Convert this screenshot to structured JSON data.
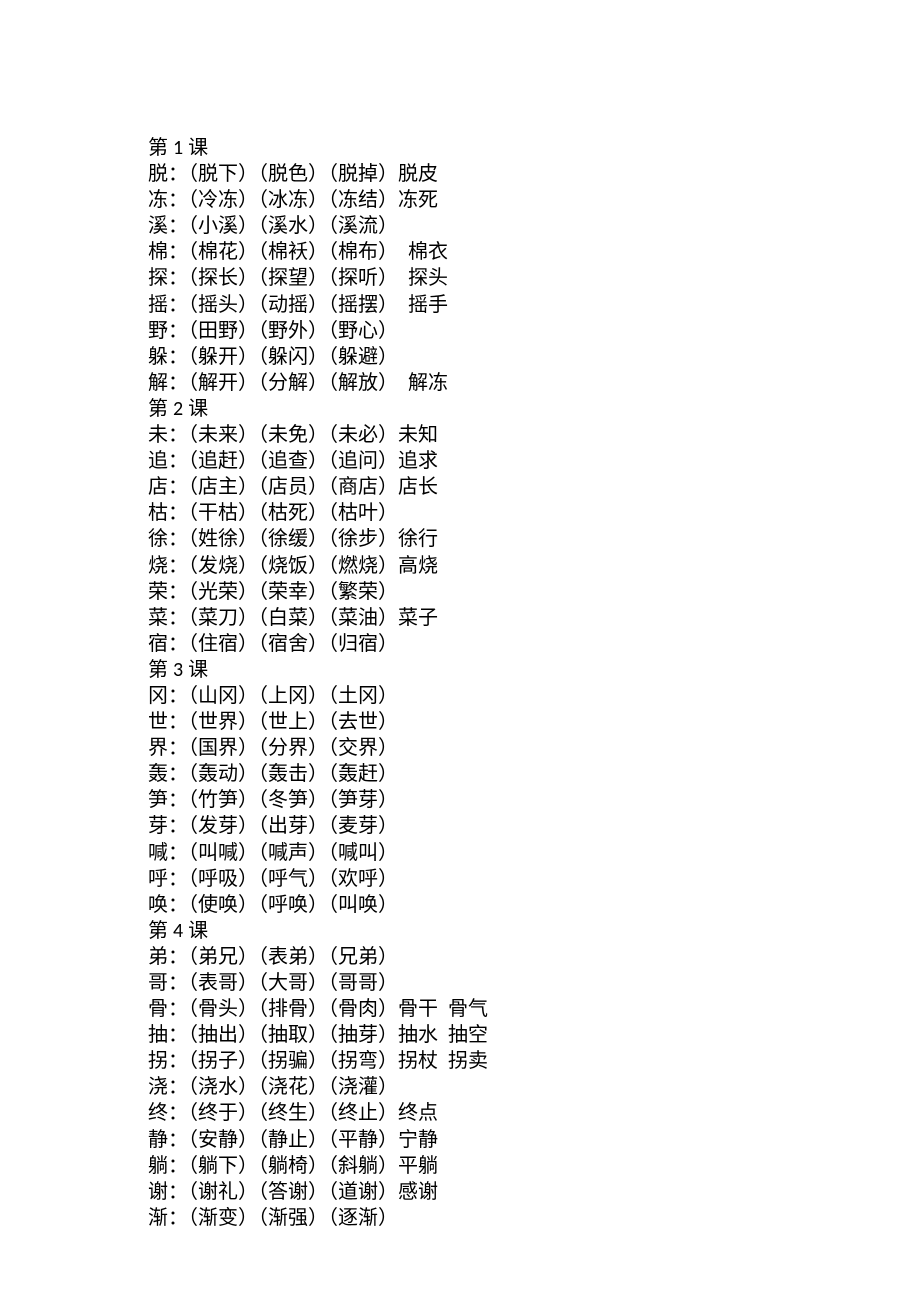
{
  "lessons": [
    {
      "title_pre": "第 ",
      "title_num": "1",
      "title_post": " 课",
      "lines": [
        "脱：（脱下）（脱色）（脱掉）脱皮",
        "冻：（冷冻）（冰冻）（冻结）冻死",
        "溪：（小溪）（溪水）（溪流）",
        "棉：（棉花）（棉袄）（棉布）  棉衣",
        "探：（探长）（探望）（探听）  探头",
        "摇：（摇头）（动摇）（摇摆）  摇手",
        "野：（田野）（野外）（野心）",
        "躲：（躲开）（躲闪）（躲避）",
        "解：（解开）（分解）（解放）  解冻"
      ]
    },
    {
      "title_pre": "第 ",
      "title_num": "2",
      "title_post": " 课",
      "lines": [
        "未：（未来）（未免）（未必）未知",
        "追：（追赶）（追查）（追问）追求",
        "店：（店主）（店员）（商店）店长",
        "枯：（干枯）（枯死）（枯叶）",
        "徐：（姓徐）（徐缓）（徐步）徐行",
        "烧：（发烧）（烧饭）（燃烧）高烧",
        "荣：（光荣）（荣幸）（繁荣）",
        "菜：（菜刀）（白菜）（菜油）菜子",
        "宿：（住宿）（宿舍）（归宿）"
      ]
    },
    {
      "title_pre": "第 ",
      "title_num": "3",
      "title_post": " 课",
      "lines": [
        "冈：（山冈）（上冈）（土冈）",
        "世：（世界）（世上）（去世）",
        "界：（国界）（分界）（交界）",
        "轰：（轰动）（轰击）（轰赶）",
        "笋：（竹笋）（冬笋）（笋芽）",
        "芽：（发芽）（出芽）（麦芽）",
        "喊：（叫喊）（喊声）（喊叫）",
        "呼：（呼吸）（呼气）（欢呼）",
        "唤：（使唤）（呼唤）（叫唤）"
      ]
    },
    {
      "title_pre": "第 ",
      "title_num": "4",
      "title_post": " 课",
      "lines": [
        "弟：（弟兄）（表弟）（兄弟）",
        "哥：（表哥）（大哥）（哥哥）",
        "骨：（骨头）（排骨）（骨肉）骨干  骨气",
        "抽：（抽出）（抽取）（抽芽）抽水  抽空",
        "拐：（拐子）（拐骗）（拐弯）拐杖  拐卖",
        "浇：（浇水）（浇花）（浇灌）",
        "终：（终于）（终生）（终止）终点",
        "静：（安静）（静止）（平静）宁静",
        "躺：（躺下）（躺椅）（斜躺）平躺",
        "谢：（谢礼）（答谢）（道谢）感谢",
        "渐：（渐变）（渐强）（逐渐）"
      ]
    }
  ]
}
